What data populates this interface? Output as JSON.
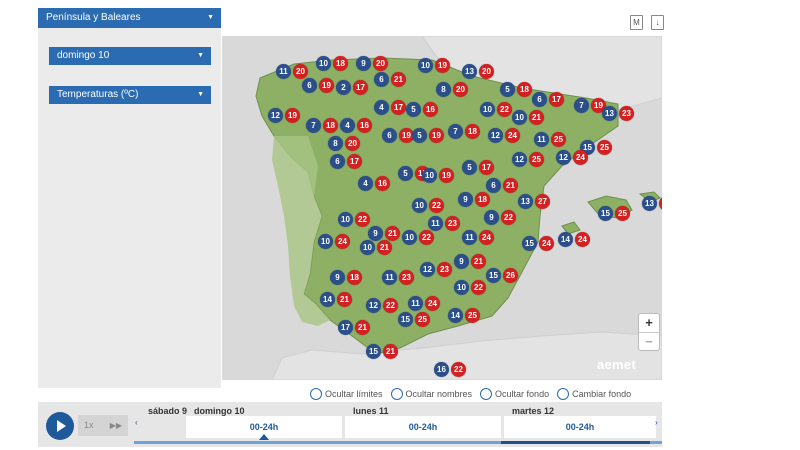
{
  "controls": {
    "region": "Península y Baleares",
    "day": "domingo 10",
    "variable": "Temperaturas (ºC)"
  },
  "toolbar": {
    "map_icon": "M",
    "download_icon": "↓"
  },
  "map": {
    "logo": "aemet",
    "zoom_in": "+",
    "zoom_out": "−",
    "stations": [
      {
        "min": 11,
        "max": 20
      },
      {
        "min": 10,
        "max": 18
      },
      {
        "min": 9,
        "max": 20
      },
      {
        "min": 10,
        "max": 19
      },
      {
        "min": 13,
        "max": 20
      },
      {
        "min": 6,
        "max": 19
      },
      {
        "min": 2,
        "max": 17
      },
      {
        "min": 6,
        "max": 21
      },
      {
        "min": 8,
        "max": 20
      },
      {
        "min": 5,
        "max": 18
      },
      {
        "min": 6,
        "max": 17
      },
      {
        "min": 7,
        "max": 19
      },
      {
        "min": 13,
        "max": 23
      },
      {
        "min": 12,
        "max": 19
      },
      {
        "min": 7,
        "max": 18
      },
      {
        "min": 4,
        "max": 16
      },
      {
        "min": 4,
        "max": 17
      },
      {
        "min": 5,
        "max": 16
      },
      {
        "min": 10,
        "max": 22
      },
      {
        "min": 10,
        "max": 21
      },
      {
        "min": 6,
        "max": 19
      },
      {
        "min": 5,
        "max": 19
      },
      {
        "min": 7,
        "max": 18
      },
      {
        "min": 12,
        "max": 24
      },
      {
        "min": 11,
        "max": 25
      },
      {
        "min": 8,
        "max": 20
      },
      {
        "min": 15,
        "max": 25
      },
      {
        "min": 6,
        "max": 17
      },
      {
        "min": 12,
        "max": 25
      },
      {
        "min": 12,
        "max": 24
      },
      {
        "min": 5,
        "max": 15
      },
      {
        "min": 10,
        "max": 19
      },
      {
        "min": 5,
        "max": 17
      },
      {
        "min": 4,
        "max": 16
      },
      {
        "min": 9,
        "max": 18
      },
      {
        "min": 6,
        "max": 21
      },
      {
        "min": 13,
        "max": 27
      },
      {
        "min": 10,
        "max": 22
      },
      {
        "min": 15,
        "max": 25
      },
      {
        "min": 13,
        "max": 22
      },
      {
        "min": 10,
        "max": 22
      },
      {
        "min": 11,
        "max": 23
      },
      {
        "min": 9,
        "max": 22
      },
      {
        "min": 9,
        "max": 21
      },
      {
        "min": 10,
        "max": 22
      },
      {
        "min": 10,
        "max": 24
      },
      {
        "min": 10,
        "max": 21
      },
      {
        "min": 11,
        "max": 24
      },
      {
        "min": 15,
        "max": 24
      },
      {
        "min": 14,
        "max": 24
      },
      {
        "min": 9,
        "max": 18
      },
      {
        "min": 11,
        "max": 23
      },
      {
        "min": 12,
        "max": 23
      },
      {
        "min": 9,
        "max": 21
      },
      {
        "min": 15,
        "max": 26
      },
      {
        "min": 14,
        "max": 21
      },
      {
        "min": 12,
        "max": 22
      },
      {
        "min": 11,
        "max": 24
      },
      {
        "min": 10,
        "max": 22
      },
      {
        "min": 14,
        "max": 25
      },
      {
        "min": 15,
        "max": 25
      },
      {
        "min": 17,
        "max": 21
      },
      {
        "min": 15,
        "max": 21
      },
      {
        "min": 16,
        "max": 22
      }
    ]
  },
  "toggles": [
    {
      "label": "Ocultar límites"
    },
    {
      "label": "Ocultar nombres"
    },
    {
      "label": "Ocultar fondo"
    },
    {
      "label": "Cambiar fondo"
    }
  ],
  "timeline": {
    "speed": "1x",
    "days": [
      {
        "name": "sábado 9",
        "slot": ""
      },
      {
        "name": "domingo 10",
        "slot": "00-24h"
      },
      {
        "name": "lunes 11",
        "slot": "00-24h"
      },
      {
        "name": "martes 12",
        "slot": "00-24h"
      }
    ]
  }
}
